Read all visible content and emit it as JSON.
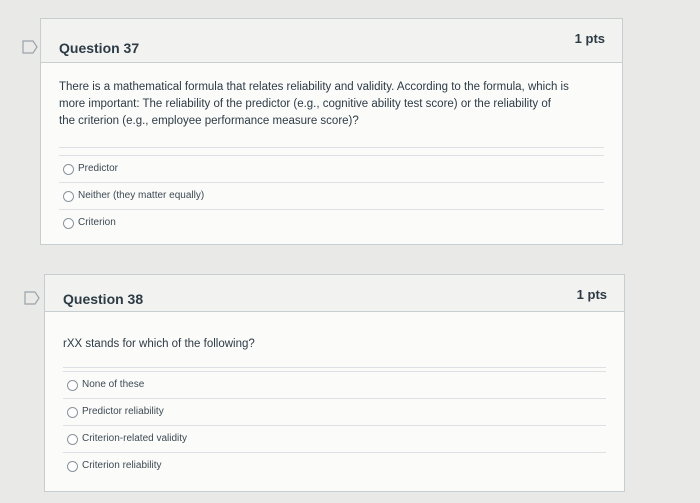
{
  "questions": [
    {
      "title": "Question 37",
      "points": "1 pts",
      "text_lines": [
        "There is a mathematical formula that relates reliability and validity. According to the formula, which is",
        "more important: The reliability of the predictor (e.g., cognitive ability test score) or the reliability of",
        "the criterion (e.g., employee performance measure score)?"
      ],
      "answers": [
        "Predictor",
        "Neither (they matter equally)",
        "Criterion"
      ]
    },
    {
      "title": "Question 38",
      "points": "1 pts",
      "text_lines": [
        "rXX stands for which of the following?"
      ],
      "answers": [
        "None of these",
        "Predictor reliability",
        "Criterion-related validity",
        "Criterion reliability"
      ]
    }
  ],
  "icons": {
    "flag": "flag-icon",
    "radio": "radio-button"
  },
  "colors": {
    "background": "#e9e9e7",
    "card": "#fbfbfa",
    "header": "#f2f2f1",
    "text": "#2d3b45"
  }
}
